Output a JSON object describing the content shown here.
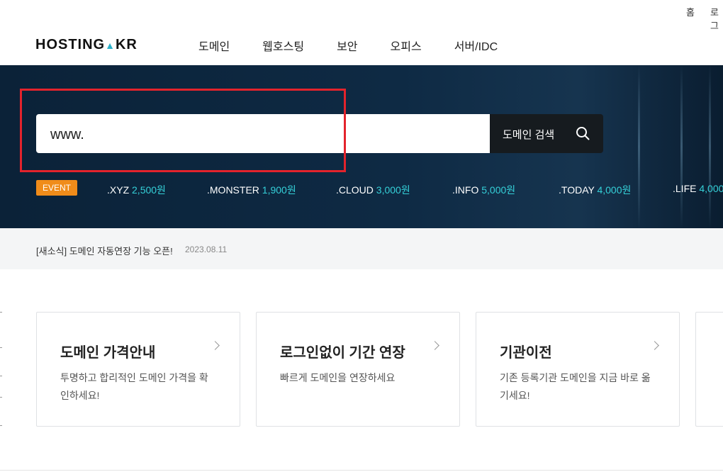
{
  "util_links": [
    "홈",
    "로그"
  ],
  "logo": {
    "text_main": "HOSTING",
    "text_suffix": "KR"
  },
  "gnb": [
    {
      "label": "도메인"
    },
    {
      "label": "웹호스팅"
    },
    {
      "label": "보안"
    },
    {
      "label": "오피스"
    },
    {
      "label": "서버/IDC"
    }
  ],
  "search": {
    "value": "www.",
    "button_label": "도메인 검색",
    "icon": "search-icon"
  },
  "event": {
    "badge": "EVENT",
    "tlds": [
      {
        "name": ".XYZ",
        "price": "2,500원"
      },
      {
        "name": ".MONSTER",
        "price": "1,900원"
      },
      {
        "name": ".CLOUD",
        "price": "3,000원"
      },
      {
        "name": ".INFO",
        "price": "5,000원"
      },
      {
        "name": ".TODAY",
        "price": "4,000원"
      },
      {
        "name": ".LIFE",
        "price": "4,000"
      }
    ]
  },
  "notice": {
    "text": "[새소식] 도메인 자동연장 기능 오픈!",
    "date": "2023.08.11"
  },
  "cards": [
    {
      "title": "도메인 가격안내",
      "desc": "투명하고 합리적인 도메인 가격을 확인하세요!"
    },
    {
      "title": "로그인없이 기간 연장",
      "desc": "빠르게 도메인을 연장하세요"
    },
    {
      "title": "기관이전",
      "desc": "기존 등록기관 도메인을 지금 바로 옮기세요!"
    }
  ],
  "colors": {
    "hero_bg": "#0e2a44",
    "accent_price": "#35d0d8",
    "event_badge": "#f08c1a",
    "highlight": "#e3232c"
  }
}
